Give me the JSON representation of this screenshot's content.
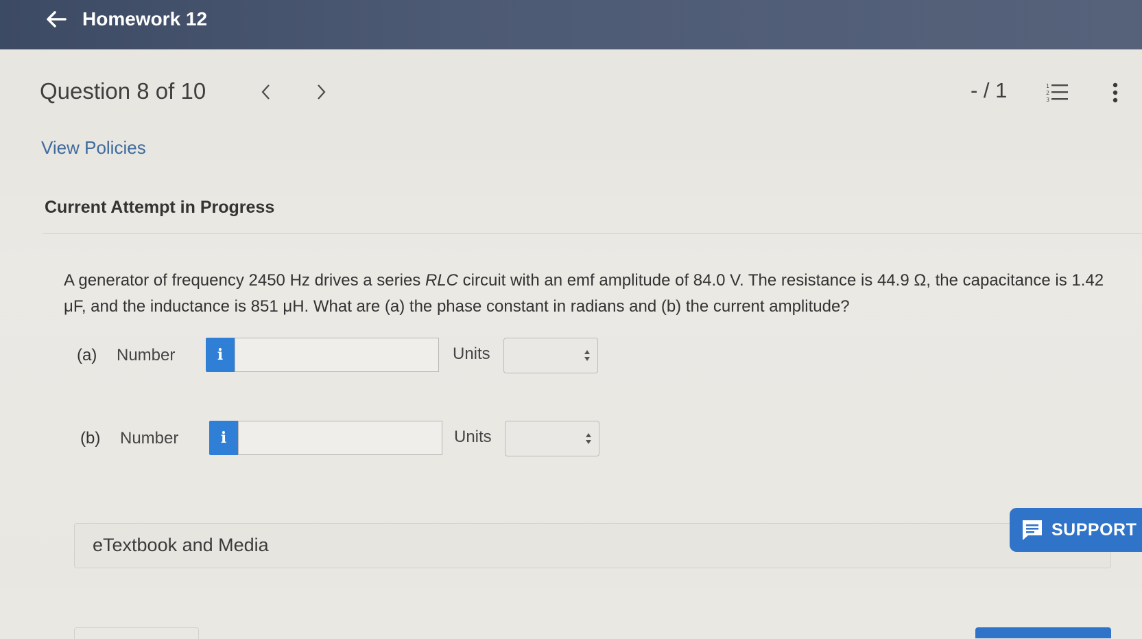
{
  "header": {
    "title": "Homework 12",
    "back_icon": "arrow-left-icon"
  },
  "question_nav": {
    "title": "Question 8 of 10",
    "prev_icon": "chevron-left-icon",
    "next_icon": "chevron-right-icon",
    "score": "- / 1",
    "list_icon": "numbered-list-icon",
    "more_icon": "more-vertical-icon"
  },
  "links": {
    "view_policies": "View Policies"
  },
  "attempt": {
    "heading": "Current Attempt in Progress"
  },
  "question": {
    "text_1": "A generator of frequency 2450 Hz drives a series ",
    "text_italic": "RLC",
    "text_2": " circuit with an emf amplitude of 84.0 V. The resistance is 44.9 Ω, the capacitance is 1.42 μF, and the inductance is 851 μH. What are (a) the phase constant in radians and (b) the current amplitude?"
  },
  "parts": [
    {
      "letter": "(a)",
      "label": "Number",
      "info": "i",
      "value": "",
      "units_label": "Units",
      "units_value": ""
    },
    {
      "letter": "(b)",
      "label": "Number",
      "info": "i",
      "value": "",
      "units_label": "Units",
      "units_value": ""
    }
  ],
  "etextbook": {
    "label": "eTextbook and Media"
  },
  "support": {
    "label": "SUPPORT",
    "icon": "chat-bubble-icon"
  },
  "colors": {
    "topbar": "#4a5670",
    "accent_blue": "#2f7fd6",
    "link": "#3e6a9c"
  }
}
